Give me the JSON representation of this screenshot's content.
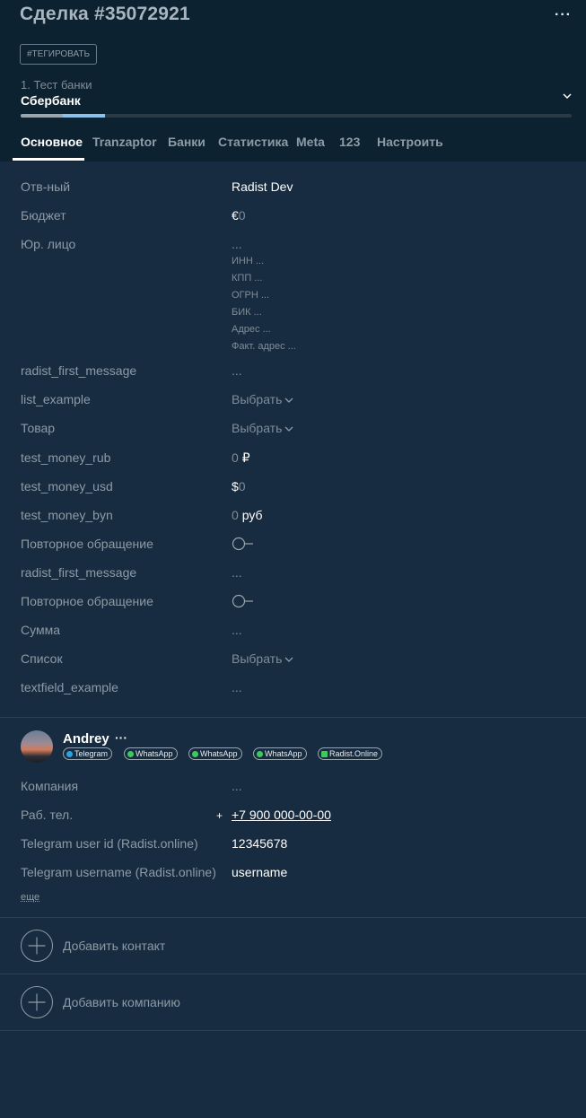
{
  "header": {
    "deal_title": "Сделка #35072921",
    "more_label": "···",
    "tag_button": "#ТЕГИРОВАТЬ",
    "stage": "1. Тест банки",
    "pipeline": "Сбербанк",
    "progress_stages_done": 2
  },
  "tabs": [
    "Основное",
    "Tranzaptor",
    "Банки",
    "Статистика",
    "Meta",
    "123",
    "Настроить"
  ],
  "fields": {
    "responsible": {
      "label": "Отв-ный",
      "value": "Radist Dev"
    },
    "budget": {
      "label": "Бюджет",
      "currency": "€",
      "value": "0"
    },
    "legal_entity": {
      "label": "Юр. лицо",
      "value": "...",
      "sub": [
        {
          "name": "ИНН",
          "value": "..."
        },
        {
          "name": "КПП",
          "value": "..."
        },
        {
          "name": "ОГРН",
          "value": "..."
        },
        {
          "name": "БИК",
          "value": "..."
        },
        {
          "name": "Адрес",
          "value": "..."
        },
        {
          "name": "Факт. адрес",
          "value": "..."
        }
      ]
    },
    "radist_first_message_1": {
      "label": "radist_first_message",
      "value": "..."
    },
    "list_example": {
      "label": "list_example",
      "value": "Выбрать"
    },
    "product": {
      "label": "Товар",
      "value": "Выбрать"
    },
    "test_money_rub": {
      "label": "test_money_rub",
      "value": "0",
      "currency": "₽"
    },
    "test_money_usd": {
      "label": "test_money_usd",
      "currency": "$",
      "value": "0"
    },
    "test_money_byn": {
      "label": "test_money_byn",
      "value": "0",
      "currency": "руб"
    },
    "repeat_request_1": {
      "label": "Повторное обращение",
      "value": "off"
    },
    "radist_first_message_2": {
      "label": "radist_first_message",
      "value": "..."
    },
    "repeat_request_2": {
      "label": "Повторное обращение",
      "value": "off"
    },
    "sum": {
      "label": "Сумма",
      "value": "..."
    },
    "list": {
      "label": "Список",
      "value": "Выбрать"
    },
    "textfield_example": {
      "label": "textfield_example",
      "value": "..."
    }
  },
  "contact": {
    "name": "Andrey",
    "more_label": "···",
    "channels": [
      {
        "label": "Telegram",
        "color": "#2aa3e2",
        "icon": "telegram-icon"
      },
      {
        "label": "WhatsApp",
        "color": "#3ccb5b",
        "icon": "whatsapp-icon"
      },
      {
        "label": "WhatsApp",
        "color": "#3ccb5b",
        "icon": "whatsapp-icon"
      },
      {
        "label": "WhatsApp",
        "color": "#3ccb5b",
        "icon": "whatsapp-icon"
      },
      {
        "label": "Radist.Online",
        "color": "#3ccb5b",
        "icon": "radist-icon"
      }
    ],
    "company": {
      "label": "Компания",
      "value": "..."
    },
    "work_phone": {
      "label": "Раб. тел.",
      "value": "+7 900 000-00-00",
      "add_label": "+"
    },
    "telegram_user_id": {
      "label": "Telegram user id (Radist.online)",
      "value": "12345678"
    },
    "telegram_username": {
      "label": "Telegram username (Radist.online)",
      "value": "username"
    },
    "more_link": "еще"
  },
  "actions": {
    "add_contact": "Добавить контакт",
    "add_company": "Добавить компанию"
  }
}
